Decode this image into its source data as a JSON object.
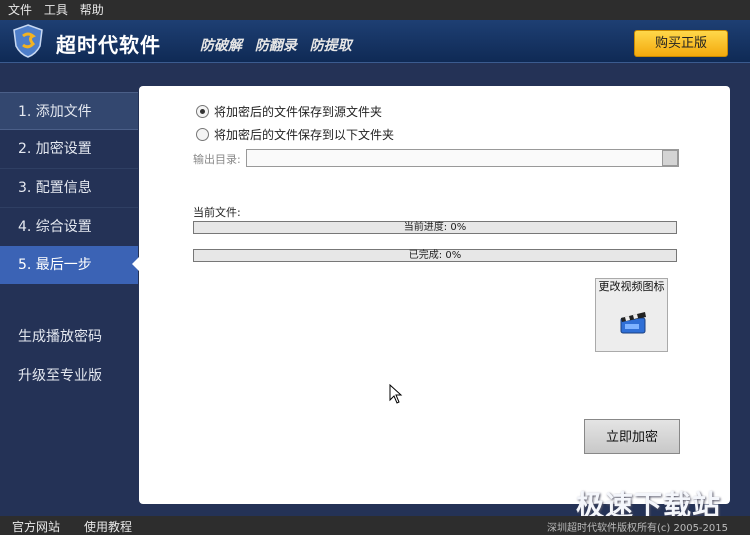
{
  "menu": {
    "items": [
      "文件",
      "工具",
      "帮助"
    ]
  },
  "header": {
    "app_title": "超时代软件",
    "slogans": [
      "防破解",
      "防翻录",
      "防提取"
    ],
    "buy_button": "购买正版"
  },
  "sidebar": {
    "steps": [
      {
        "label": "1. 添加文件"
      },
      {
        "label": "2. 加密设置"
      },
      {
        "label": "3. 配置信息"
      },
      {
        "label": "4. 综合设置"
      },
      {
        "label": "5. 最后一步"
      }
    ],
    "active_step": 5,
    "links": [
      "生成播放密码",
      "升级至专业版"
    ]
  },
  "main": {
    "radio_source": "将加密后的文件保存到源文件夹",
    "radio_other": "将加密后的文件保存到以下文件夹",
    "output_dir_label": "输出目录:",
    "output_dir_value": "",
    "current_file_label": "当前文件:",
    "current_progress_label": "当前进度: 0%",
    "current_progress_value": 0,
    "completed_label": "已完成: 0%",
    "completed_value": 0,
    "change_icon_label": "更改视频图标",
    "encrypt_button": "立即加密"
  },
  "footer": {
    "website": "官方网站",
    "tutorial": "使用教程",
    "copyright": "深圳超时代软件版权所有(c) 2005-2015"
  },
  "watermark": "极速下载站",
  "colors": {
    "accent": "#3b63b5",
    "header": "#0f2a55",
    "buy": "#f3a90d"
  }
}
